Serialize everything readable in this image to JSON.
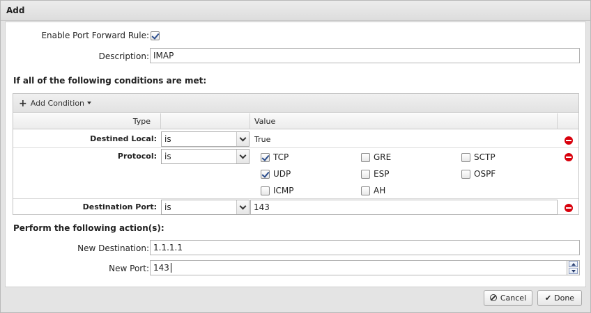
{
  "dialog": {
    "title": "Add"
  },
  "form": {
    "enable_label": "Enable Port Forward Rule:",
    "enable_checked": true,
    "description_label": "Description:",
    "description_value": "IMAP"
  },
  "conditions": {
    "heading": "If all of the following conditions are met:",
    "add_condition_label": "Add Condition",
    "columns": {
      "type": "Type",
      "op": "",
      "value": "Value"
    },
    "rows": [
      {
        "label": "Destined Local:",
        "operator": "is",
        "value": "True"
      },
      {
        "label": "Protocol:",
        "operator": "is"
      },
      {
        "label": "Destination Port:",
        "operator": "is",
        "value": "143"
      }
    ],
    "protocols": [
      {
        "name": "TCP",
        "checked": true
      },
      {
        "name": "GRE",
        "checked": false
      },
      {
        "name": "SCTP",
        "checked": false
      },
      {
        "name": "UDP",
        "checked": true
      },
      {
        "name": "ESP",
        "checked": false
      },
      {
        "name": "OSPF",
        "checked": false
      },
      {
        "name": "ICMP",
        "checked": false
      },
      {
        "name": "AH",
        "checked": false
      }
    ]
  },
  "actions": {
    "heading": "Perform the following action(s):",
    "new_destination_label": "New Destination:",
    "new_destination_value": "1.1.1.1",
    "new_port_label": "New Port:",
    "new_port_value": "143"
  },
  "footer": {
    "cancel_label": "Cancel",
    "done_label": "Done"
  },
  "colors": {
    "remove": "#d8000c",
    "checkmark": "#2a4c8c"
  }
}
